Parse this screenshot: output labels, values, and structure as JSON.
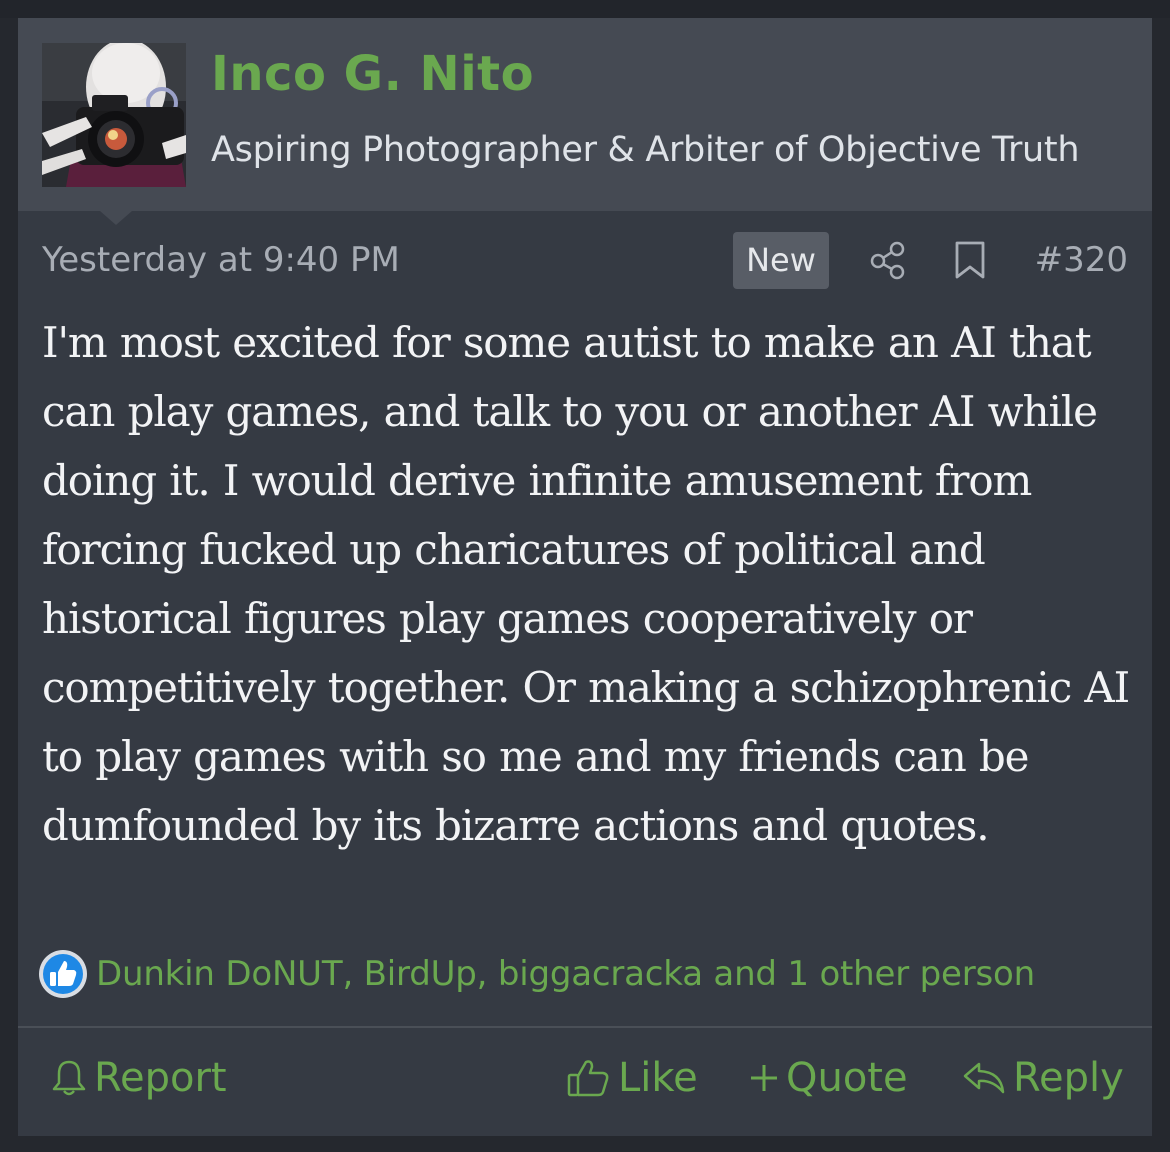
{
  "post": {
    "author": {
      "name": "Inco G. Nito",
      "title": "Aspiring Photographer & Arbiter of Objective Truth",
      "avatar_icon": "photographer-avatar"
    },
    "timestamp": "Yesterday at 9:40 PM",
    "badge": "New",
    "post_number": "#320",
    "body": "I'm most excited for some autist to make an AI that can play games, and talk to you or another AI while doing it. I would derive infinite amusement from forcing fucked up charicatures of political and historical figures play games cooperatively or competitively together. Or making a schizophrenic AI to play games with so me and my friends can be dumfounded by its bizarre actions and quotes.",
    "reactions": {
      "icon": "thumbs-up-reaction-icon",
      "users_text": "Dunkin DoNUT, BirdUp, biggacracka and 1 other person"
    },
    "actions": {
      "report": "Report",
      "like": "Like",
      "quote": "Quote",
      "reply": "Reply"
    }
  },
  "colors": {
    "accent": "#6aa84f",
    "header_bg": "#454a53",
    "post_bg": "#353a43",
    "page_bg": "#25282e",
    "reaction_blue": "#1e88e5"
  }
}
